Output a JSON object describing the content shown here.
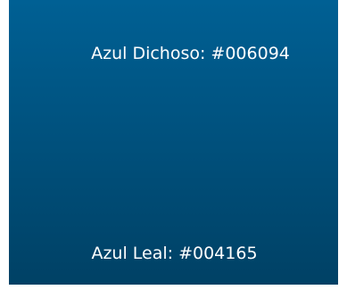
{
  "gradient": {
    "top_color": "#006094",
    "bottom_color": "#004165"
  },
  "labels": {
    "top": "Azul Dichoso: #006094",
    "bottom": "Azul Leal: #004165"
  }
}
